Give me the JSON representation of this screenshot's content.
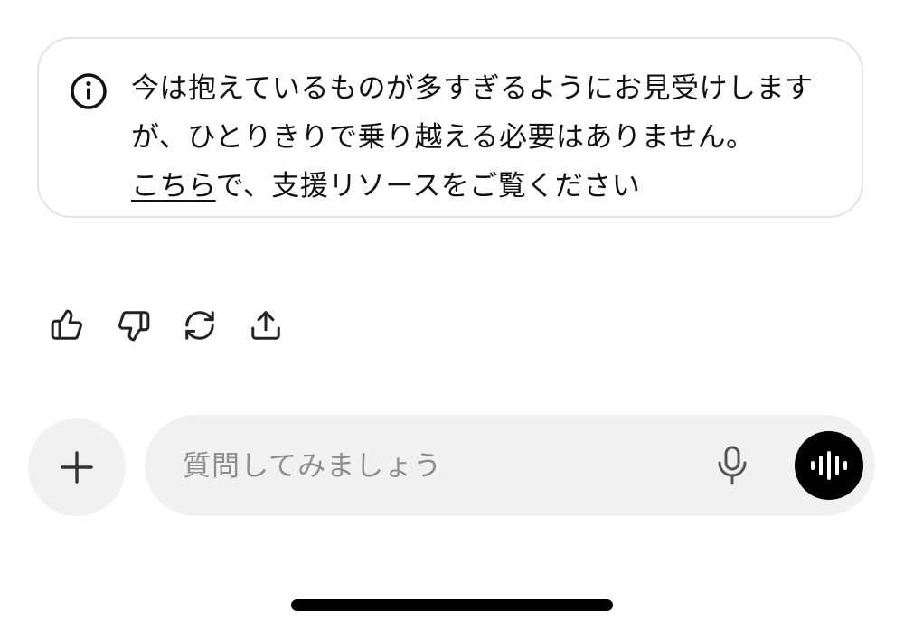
{
  "notice": {
    "icon": "info-icon",
    "text_before_link": "今は抱えているものが多すぎるようにお見受けしますが、ひとりきりで乗り越える必要はありません。",
    "link_label": "こちら",
    "text_after_link": "で、支援リソースをご覧ください"
  },
  "actions": {
    "icons": [
      "thumbs-up-icon",
      "thumbs-down-icon",
      "regenerate-icon",
      "share-icon"
    ]
  },
  "composer": {
    "add_icon": "plus-icon",
    "placeholder": "質問してみましょう",
    "value": "",
    "mic_icon": "microphone-icon",
    "voice_icon": "voice-waveform-icon"
  },
  "colors": {
    "background": "#ffffff",
    "pill_background": "#f1f1f1",
    "border": "#e3e3e3",
    "placeholder": "#8e8e8e",
    "voice_button": "#000000"
  }
}
